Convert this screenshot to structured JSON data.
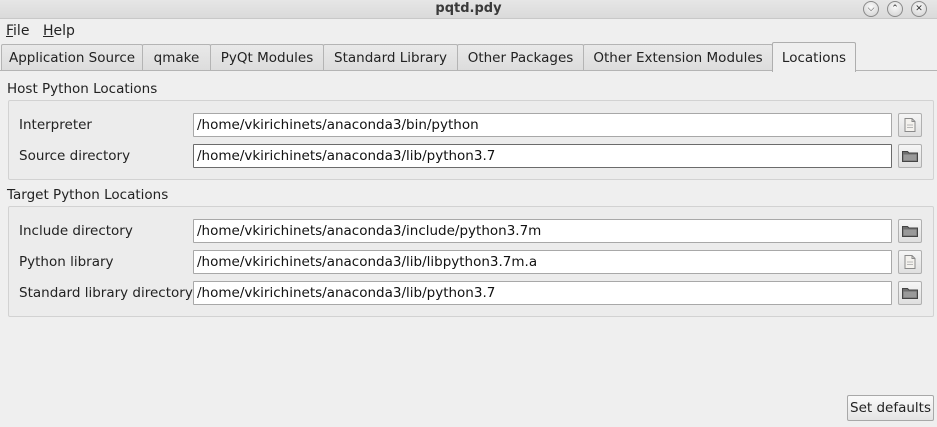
{
  "window": {
    "title": "pqtd.pdy",
    "buttons": [
      "minimize",
      "maximize"
    ]
  },
  "menubar": {
    "items": [
      {
        "label_underlined": "F",
        "label_rest": "ile"
      },
      {
        "label_underlined": "H",
        "label_rest": "elp"
      }
    ]
  },
  "tabs": [
    {
      "label": "Application Source"
    },
    {
      "label": "qmake"
    },
    {
      "label": "PyQt Modules"
    },
    {
      "label": "Standard Library"
    },
    {
      "label": "Other Packages"
    },
    {
      "label": "Other Extension Modules"
    },
    {
      "label": "Locations",
      "active": true
    }
  ],
  "host_group": {
    "title": "Host Python Locations",
    "rows": [
      {
        "label": "Interpreter",
        "value": "/home/vkirichinets/anaconda3/bin/python",
        "browse_icon": "file-icon"
      },
      {
        "label": "Source directory",
        "value": "/home/vkirichinets/anaconda3/lib/python3.7",
        "browse_icon": "folder-icon",
        "focused": true
      }
    ]
  },
  "target_group": {
    "title": "Target Python Locations",
    "rows": [
      {
        "label": "Include directory",
        "value": "/home/vkirichinets/anaconda3/include/python3.7m",
        "browse_icon": "folder-icon"
      },
      {
        "label": "Python library",
        "value": "/home/vkirichinets/anaconda3/lib/libpython3.7m.a",
        "browse_icon": "file-icon"
      },
      {
        "label": "Standard library directory",
        "value": "/home/vkirichinets/anaconda3/lib/python3.7",
        "browse_icon": "folder-icon"
      }
    ]
  },
  "footer": {
    "set_defaults_label": "Set defaults"
  }
}
